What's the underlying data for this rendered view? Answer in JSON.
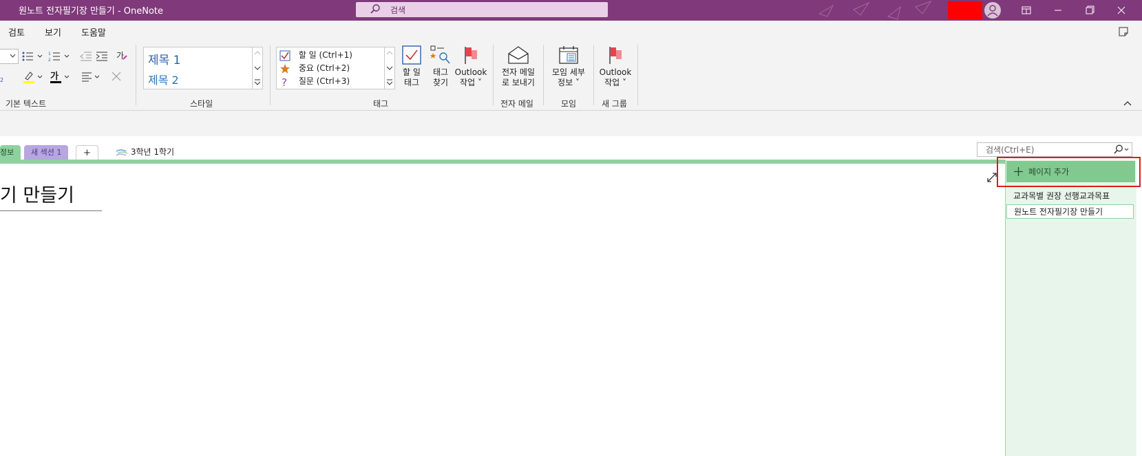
{
  "window": {
    "title": "원노트 전자필기장 만들기  -  OneNote",
    "search_placeholder": "검색"
  },
  "menu": [
    "검토",
    "보기",
    "도움말"
  ],
  "ribbon": {
    "groups": {
      "basic_text": "기본 텍스트",
      "styles": "스타일",
      "tags": "태그",
      "email": "전자 메일",
      "meetings": "모임",
      "new_group": "새 그룹"
    },
    "styles": {
      "heading1": "제목 1",
      "heading2": "제목 2"
    },
    "tags": [
      {
        "label": "할 일 (Ctrl+1)",
        "icon": "checkbox-icon"
      },
      {
        "label": "중요 (Ctrl+2)",
        "icon": "star-icon"
      },
      {
        "label": "질문 (Ctrl+3)",
        "icon": "question-icon"
      }
    ],
    "buttons": {
      "todo_tag": [
        "할 일",
        "태그"
      ],
      "find_tags": [
        "태그",
        "찾기"
      ],
      "outlook_task": [
        "Outlook",
        "작업 ˅"
      ],
      "email_page": [
        "전자 메일",
        "로 보내기"
      ],
      "meeting_details": [
        "모임 세부",
        "정보 ˅"
      ],
      "outlook_task2": [
        "Outlook",
        "작업 ˅"
      ]
    }
  },
  "sections": {
    "partial_tab": "정보",
    "new_section": "새 섹션 1",
    "add_tab": "+",
    "notebook": "3학년 1학기"
  },
  "page_search_placeholder": "검색(Ctrl+E)",
  "pages": {
    "add_page": "페이지 추가",
    "items": [
      "교과목별 권장 선행교과목표",
      "원노트 전자필기장 만들기"
    ]
  },
  "canvas": {
    "page_title": "기 만들기"
  },
  "colors": {
    "titlebar": "#80397b",
    "section_green": "#8fd19e",
    "highlight_red": "#e01b1b"
  }
}
